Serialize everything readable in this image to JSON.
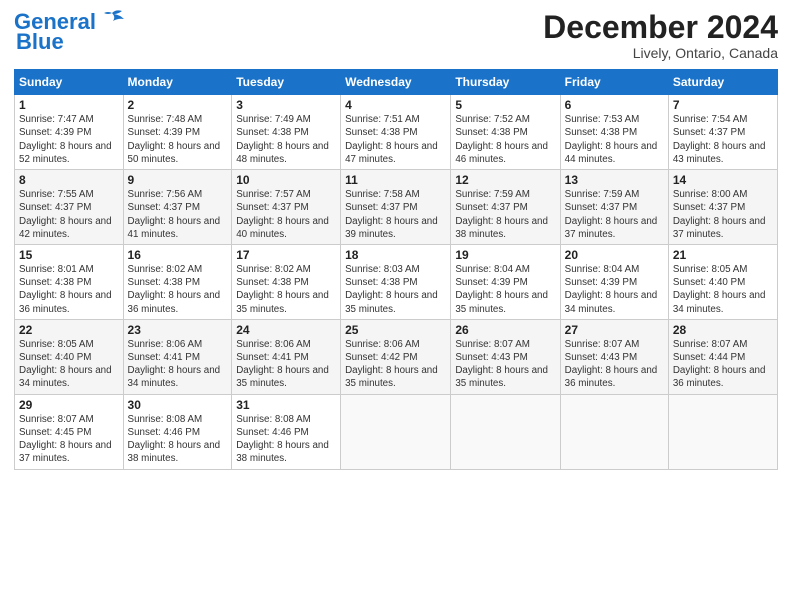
{
  "header": {
    "logo_line1": "General",
    "logo_line2": "Blue",
    "month": "December 2024",
    "location": "Lively, Ontario, Canada"
  },
  "weekdays": [
    "Sunday",
    "Monday",
    "Tuesday",
    "Wednesday",
    "Thursday",
    "Friday",
    "Saturday"
  ],
  "weeks": [
    [
      {
        "day": "1",
        "sunrise": "Sunrise: 7:47 AM",
        "sunset": "Sunset: 4:39 PM",
        "daylight": "Daylight: 8 hours and 52 minutes."
      },
      {
        "day": "2",
        "sunrise": "Sunrise: 7:48 AM",
        "sunset": "Sunset: 4:39 PM",
        "daylight": "Daylight: 8 hours and 50 minutes."
      },
      {
        "day": "3",
        "sunrise": "Sunrise: 7:49 AM",
        "sunset": "Sunset: 4:38 PM",
        "daylight": "Daylight: 8 hours and 48 minutes."
      },
      {
        "day": "4",
        "sunrise": "Sunrise: 7:51 AM",
        "sunset": "Sunset: 4:38 PM",
        "daylight": "Daylight: 8 hours and 47 minutes."
      },
      {
        "day": "5",
        "sunrise": "Sunrise: 7:52 AM",
        "sunset": "Sunset: 4:38 PM",
        "daylight": "Daylight: 8 hours and 46 minutes."
      },
      {
        "day": "6",
        "sunrise": "Sunrise: 7:53 AM",
        "sunset": "Sunset: 4:38 PM",
        "daylight": "Daylight: 8 hours and 44 minutes."
      },
      {
        "day": "7",
        "sunrise": "Sunrise: 7:54 AM",
        "sunset": "Sunset: 4:37 PM",
        "daylight": "Daylight: 8 hours and 43 minutes."
      }
    ],
    [
      {
        "day": "8",
        "sunrise": "Sunrise: 7:55 AM",
        "sunset": "Sunset: 4:37 PM",
        "daylight": "Daylight: 8 hours and 42 minutes."
      },
      {
        "day": "9",
        "sunrise": "Sunrise: 7:56 AM",
        "sunset": "Sunset: 4:37 PM",
        "daylight": "Daylight: 8 hours and 41 minutes."
      },
      {
        "day": "10",
        "sunrise": "Sunrise: 7:57 AM",
        "sunset": "Sunset: 4:37 PM",
        "daylight": "Daylight: 8 hours and 40 minutes."
      },
      {
        "day": "11",
        "sunrise": "Sunrise: 7:58 AM",
        "sunset": "Sunset: 4:37 PM",
        "daylight": "Daylight: 8 hours and 39 minutes."
      },
      {
        "day": "12",
        "sunrise": "Sunrise: 7:59 AM",
        "sunset": "Sunset: 4:37 PM",
        "daylight": "Daylight: 8 hours and 38 minutes."
      },
      {
        "day": "13",
        "sunrise": "Sunrise: 7:59 AM",
        "sunset": "Sunset: 4:37 PM",
        "daylight": "Daylight: 8 hours and 37 minutes."
      },
      {
        "day": "14",
        "sunrise": "Sunrise: 8:00 AM",
        "sunset": "Sunset: 4:37 PM",
        "daylight": "Daylight: 8 hours and 37 minutes."
      }
    ],
    [
      {
        "day": "15",
        "sunrise": "Sunrise: 8:01 AM",
        "sunset": "Sunset: 4:38 PM",
        "daylight": "Daylight: 8 hours and 36 minutes."
      },
      {
        "day": "16",
        "sunrise": "Sunrise: 8:02 AM",
        "sunset": "Sunset: 4:38 PM",
        "daylight": "Daylight: 8 hours and 36 minutes."
      },
      {
        "day": "17",
        "sunrise": "Sunrise: 8:02 AM",
        "sunset": "Sunset: 4:38 PM",
        "daylight": "Daylight: 8 hours and 35 minutes."
      },
      {
        "day": "18",
        "sunrise": "Sunrise: 8:03 AM",
        "sunset": "Sunset: 4:38 PM",
        "daylight": "Daylight: 8 hours and 35 minutes."
      },
      {
        "day": "19",
        "sunrise": "Sunrise: 8:04 AM",
        "sunset": "Sunset: 4:39 PM",
        "daylight": "Daylight: 8 hours and 35 minutes."
      },
      {
        "day": "20",
        "sunrise": "Sunrise: 8:04 AM",
        "sunset": "Sunset: 4:39 PM",
        "daylight": "Daylight: 8 hours and 34 minutes."
      },
      {
        "day": "21",
        "sunrise": "Sunrise: 8:05 AM",
        "sunset": "Sunset: 4:40 PM",
        "daylight": "Daylight: 8 hours and 34 minutes."
      }
    ],
    [
      {
        "day": "22",
        "sunrise": "Sunrise: 8:05 AM",
        "sunset": "Sunset: 4:40 PM",
        "daylight": "Daylight: 8 hours and 34 minutes."
      },
      {
        "day": "23",
        "sunrise": "Sunrise: 8:06 AM",
        "sunset": "Sunset: 4:41 PM",
        "daylight": "Daylight: 8 hours and 34 minutes."
      },
      {
        "day": "24",
        "sunrise": "Sunrise: 8:06 AM",
        "sunset": "Sunset: 4:41 PM",
        "daylight": "Daylight: 8 hours and 35 minutes."
      },
      {
        "day": "25",
        "sunrise": "Sunrise: 8:06 AM",
        "sunset": "Sunset: 4:42 PM",
        "daylight": "Daylight: 8 hours and 35 minutes."
      },
      {
        "day": "26",
        "sunrise": "Sunrise: 8:07 AM",
        "sunset": "Sunset: 4:43 PM",
        "daylight": "Daylight: 8 hours and 35 minutes."
      },
      {
        "day": "27",
        "sunrise": "Sunrise: 8:07 AM",
        "sunset": "Sunset: 4:43 PM",
        "daylight": "Daylight: 8 hours and 36 minutes."
      },
      {
        "day": "28",
        "sunrise": "Sunrise: 8:07 AM",
        "sunset": "Sunset: 4:44 PM",
        "daylight": "Daylight: 8 hours and 36 minutes."
      }
    ],
    [
      {
        "day": "29",
        "sunrise": "Sunrise: 8:07 AM",
        "sunset": "Sunset: 4:45 PM",
        "daylight": "Daylight: 8 hours and 37 minutes."
      },
      {
        "day": "30",
        "sunrise": "Sunrise: 8:08 AM",
        "sunset": "Sunset: 4:46 PM",
        "daylight": "Daylight: 8 hours and 38 minutes."
      },
      {
        "day": "31",
        "sunrise": "Sunrise: 8:08 AM",
        "sunset": "Sunset: 4:46 PM",
        "daylight": "Daylight: 8 hours and 38 minutes."
      },
      null,
      null,
      null,
      null
    ]
  ]
}
